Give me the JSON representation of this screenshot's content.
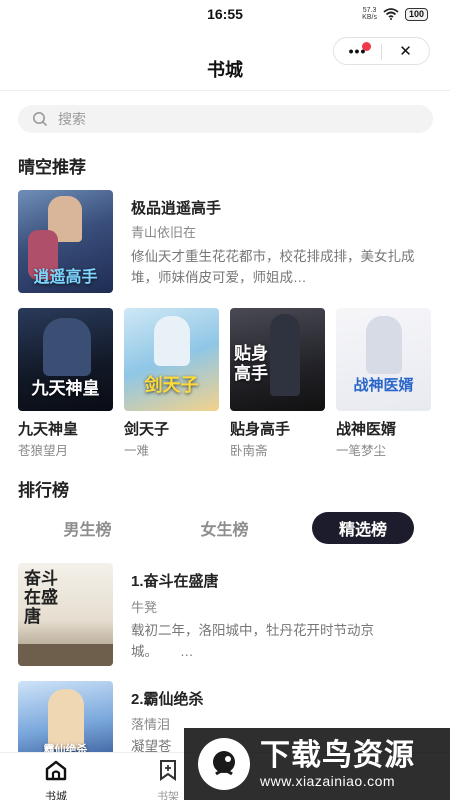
{
  "status": {
    "time": "16:55",
    "net_speed_value": "57.3",
    "net_speed_unit": "KB/s",
    "battery": "100"
  },
  "nav": {
    "title": "书城",
    "more": "•••",
    "close": "✕"
  },
  "search": {
    "placeholder": "搜索"
  },
  "recommend": {
    "title": "晴空推荐",
    "featured": {
      "title": "极品逍遥高手",
      "author": "青山依旧在",
      "desc": "修仙天才重生花花都市，校花排成排，美女扎成堆，师妹俏皮可爱，师姐成…",
      "cover_text": "逍遥高手"
    },
    "grid": [
      {
        "title": "九天神皇",
        "author": "苍狼望月",
        "cover_text": "九天神皇"
      },
      {
        "title": "剑天子",
        "author": "一难",
        "cover_text": "剑天子"
      },
      {
        "title": "贴身高手",
        "author": "卧南斋",
        "cover_text": "贴身高手"
      },
      {
        "title": "战神医婿",
        "author": "一笔梦尘",
        "cover_text": "战神医婿"
      }
    ]
  },
  "ranking": {
    "title": "排行榜",
    "tabs": [
      "男生榜",
      "女生榜",
      "精选榜"
    ],
    "active_tab": "精选榜",
    "items": [
      {
        "title": "1.奋斗在盛唐",
        "author": "牛凳",
        "desc": "载初二年，洛阳城中，牡丹花开时节动京城。",
        "more": "…",
        "cover_text": "奋斗在盛唐"
      },
      {
        "title": "2.霸仙绝杀",
        "author": "落情泪",
        "desc": "凝望苍",
        "cover_text": "霸仙绝杀"
      }
    ]
  },
  "tabbar": {
    "items": [
      "书城",
      "书架"
    ]
  },
  "watermark": {
    "main": "下载鸟资源",
    "sub": "www.xiazainiao.com"
  },
  "colors": {
    "accent_dark": "#1c1c2c",
    "red_dot": "#f0384a",
    "text_primary": "#222222",
    "text_secondary": "#888888"
  },
  "icons": {
    "search": "search-icon",
    "home": "home-icon",
    "bookmark": "bookmark-icon"
  }
}
